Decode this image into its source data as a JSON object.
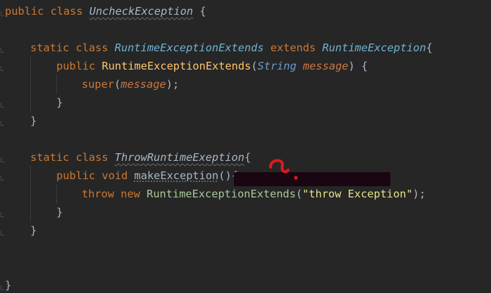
{
  "colors": {
    "background": "#262626",
    "keyword": "#cc7832",
    "function": "#ffc66d",
    "type": "#6c9bd0",
    "parameter": "#c77a45",
    "string": "#e8e18a",
    "plain": "#a9b7c6",
    "redaction": "#190612",
    "annotation": "#e0191c"
  },
  "code": {
    "l1": {
      "kw1": "public",
      "kw2": "class",
      "name": "UncheckException",
      "brace": "{"
    },
    "l2": {
      "kw1": "static",
      "kw2": "class",
      "name": "RuntimeExceptionExtends",
      "kw3": "extends",
      "parent": "RuntimeException",
      "brace": "{"
    },
    "l3": {
      "kw1": "public",
      "name": "RuntimeExceptionExtends",
      "open": "(",
      "type": "String",
      "param": "message",
      "close": ") {"
    },
    "l4": {
      "kw1": "super",
      "open": "(",
      "param": "message",
      "close": ");"
    },
    "l5": {
      "brace": "}"
    },
    "l6": {
      "brace": "}"
    },
    "l7": {
      "kw1": "static",
      "kw2": "class",
      "name": "ThrowRuntimeExeption",
      "brace": "{"
    },
    "l8": {
      "kw1": "public",
      "kw2": "void",
      "name": "makeException",
      "rest": "(){"
    },
    "l9": {
      "kw1": "throw",
      "kw2": "new",
      "name": "RuntimeExceptionExtends",
      "open": "(",
      "str": "\"throw Exception\"",
      "close": ");"
    },
    "l10": {
      "brace": "}"
    },
    "l11": {
      "brace": "}"
    },
    "l12": {
      "brace": "}"
    }
  }
}
